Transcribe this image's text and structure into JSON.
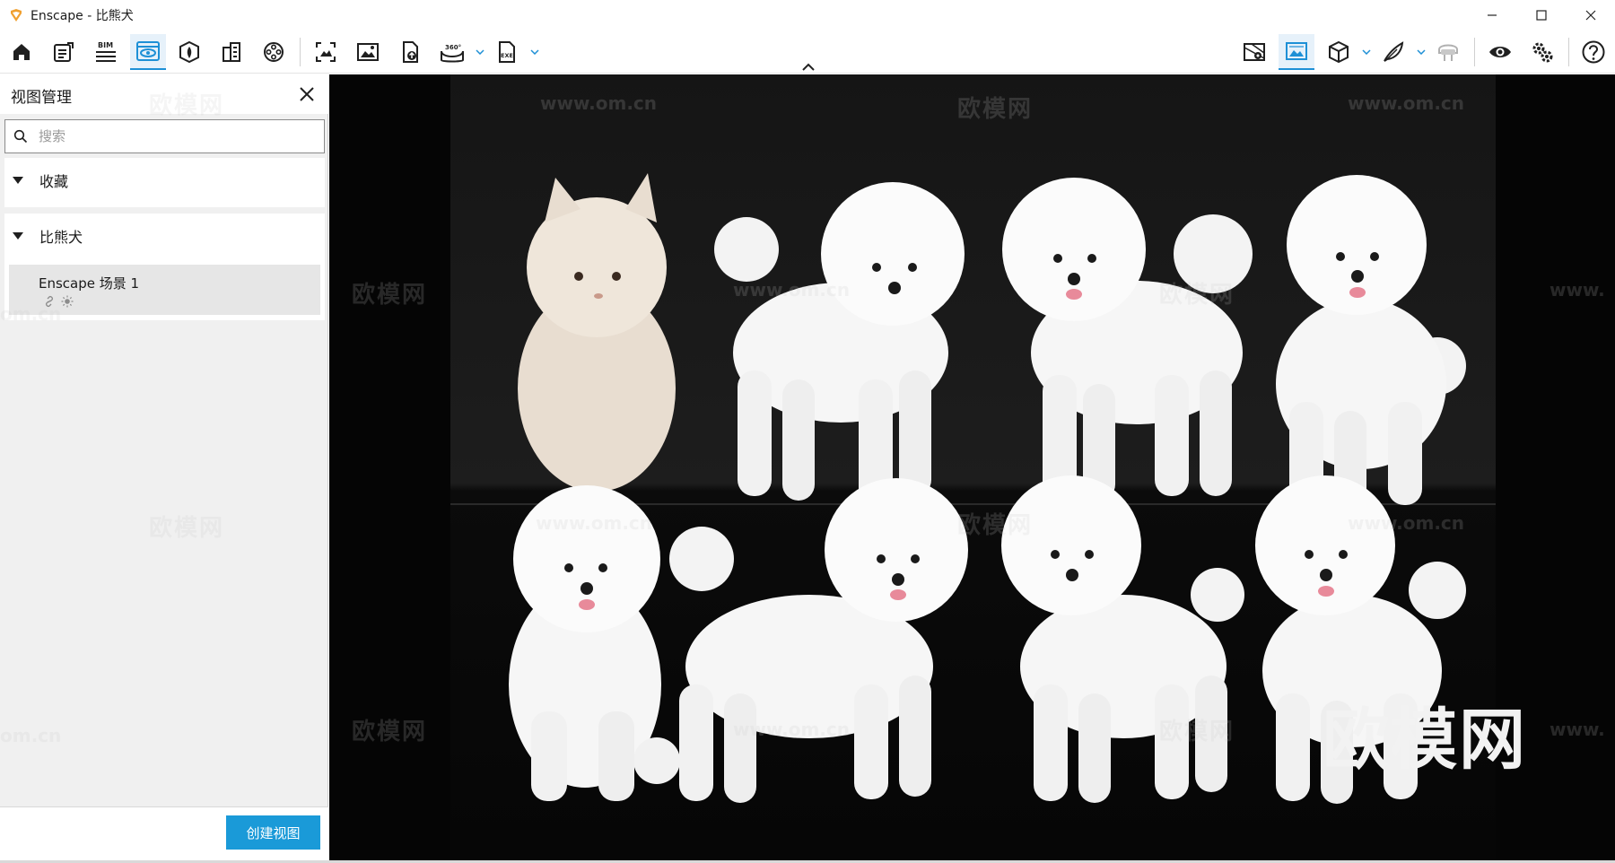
{
  "window": {
    "title": "Enscape - 比熊犬",
    "accent_color": "#1a9ad8",
    "logo_color": "#f0a030"
  },
  "toolbar": {
    "left_icons": [
      "home-icon",
      "notes-icon",
      "bim-icon",
      "view-management-icon",
      "asset-library-icon",
      "buildings-icon",
      "video-reel-icon",
      "screenshot-icon",
      "image-export-icon",
      "panorama-upload-icon",
      "panorama-360-icon",
      "exe-export-icon"
    ],
    "bim_label": "BIM",
    "pano_label": "360°",
    "exe_label": "EXE",
    "right_icons": [
      "map-icon",
      "render-image-icon",
      "cube-icon",
      "feather-icon",
      "vr-headset-icon",
      "eye-icon",
      "settings-icon",
      "help-icon"
    ]
  },
  "panel": {
    "title": "视图管理",
    "search_placeholder": "搜索",
    "groups": [
      {
        "label": "收藏"
      },
      {
        "label": "比熊犬",
        "items": [
          {
            "label": "Enscape 场景 1"
          }
        ]
      }
    ],
    "create_button": "创建视图"
  },
  "viewport": {
    "watermark_text": "欧模网",
    "watermark_url": "www.om.cn",
    "watermark_url_partial": "om.cn",
    "watermark_url_prefix": "www."
  }
}
